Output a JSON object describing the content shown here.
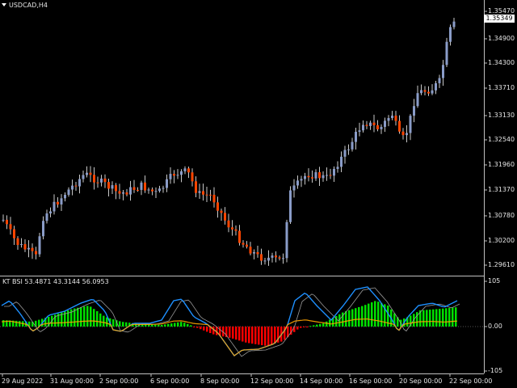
{
  "symbol_label": "USDCAD,H4",
  "indicator_label": "KT BSI 53.4871 43.3144 56.0953",
  "current_price": "1.35349",
  "price_axis": [
    "1.35470",
    "1.34900",
    "1.34300",
    "1.33710",
    "1.33130",
    "1.32540",
    "1.31960",
    "1.31370",
    "1.30780",
    "1.30200",
    "1.29610"
  ],
  "indicator_axis": [
    "105",
    "0.00",
    "-105"
  ],
  "time_axis": [
    "29 Aug 2022",
    "31 Aug 00:00",
    "2 Sep 00:00",
    "6 Sep 00:00",
    "8 Sep 00:00",
    "12 Sep 00:00",
    "14 Sep 00:00",
    "16 Sep 00:00",
    "20 Sep 00:00",
    "22 Sep 00:00"
  ],
  "colors": {
    "bull": "#8a9cc8",
    "bear": "#ff4500",
    "hist_pos": "#00e000",
    "hist_neg": "#ff0000",
    "line_blue": "#1e90ff",
    "line_orange": "#ffa500",
    "grid": "#ffffff"
  }
}
